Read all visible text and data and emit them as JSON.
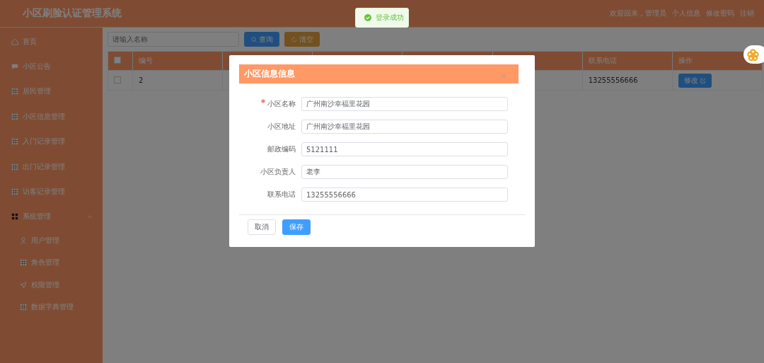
{
  "header": {
    "title": "小区刷脸认证管理系统",
    "links": [
      "欢迎回来，管理员",
      "个人信息",
      "修改密码",
      "注销"
    ]
  },
  "toast": {
    "message": "登录成功"
  },
  "sidebar": {
    "items": [
      {
        "label": "首页",
        "kind": "home"
      },
      {
        "label": "小区公告",
        "kind": "chat"
      },
      {
        "label": "居民管理",
        "kind": "grid"
      },
      {
        "label": "小区信息管理",
        "kind": "grid"
      },
      {
        "label": "入门记录管理",
        "kind": "grid"
      },
      {
        "label": "出门记录管理",
        "kind": "grid"
      },
      {
        "label": "访客记录管理",
        "kind": "grid"
      },
      {
        "label": "系统管理",
        "kind": "apps",
        "expanded": true,
        "children": [
          {
            "label": "用户管理",
            "kind": "user"
          },
          {
            "label": "角色管理",
            "kind": "grid"
          },
          {
            "label": "权限管理",
            "kind": "send"
          },
          {
            "label": "数据字典管理",
            "kind": "grid"
          }
        ]
      }
    ]
  },
  "search": {
    "placeholder": "请输入名称",
    "query_button": "查询",
    "clear_button": "清空"
  },
  "table": {
    "select_all_checked": false,
    "columns": [
      {
        "label": "编号"
      },
      {},
      {},
      {},
      {},
      {
        "label": "联系电话"
      },
      {
        "label": "操作"
      }
    ],
    "rows": [
      {
        "checked": false,
        "cells": [
          "2",
          "",
          "",
          "",
          "",
          "13255556666"
        ],
        "action": "修改"
      }
    ]
  },
  "dialog": {
    "title": "小区信息信息",
    "fields": [
      {
        "label": "小区名称",
        "required": true,
        "value": "广州南沙幸福里花园"
      },
      {
        "label": "小区地址",
        "required": false,
        "value": "广州南沙幸福里花园"
      },
      {
        "label": "邮政编码",
        "required": false,
        "value": "5121111"
      },
      {
        "label": "小区负责人",
        "required": false,
        "value": "老李"
      },
      {
        "label": "联系电话",
        "required": false,
        "value": "13255556666"
      }
    ],
    "cancel_button": "取消",
    "save_button": "保存"
  }
}
